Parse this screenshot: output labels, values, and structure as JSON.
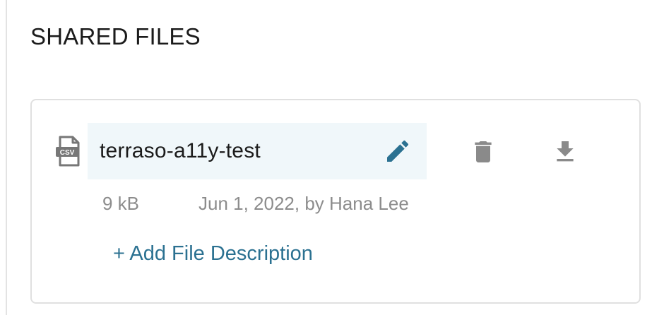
{
  "section": {
    "title": "SHARED FILES"
  },
  "file": {
    "type_badge": "CSV",
    "name": "terraso-a11y-test",
    "size": "9 kB",
    "uploaded": "Jun 1, 2022, by Hana Lee",
    "add_description_label": "+ Add File Description"
  },
  "icons": {
    "file_type": "csv-file-icon",
    "edit": "pencil-icon",
    "delete": "trash-icon",
    "download": "download-icon"
  },
  "colors": {
    "accent": "#2b7191",
    "name_highlight": "#f0f7fa",
    "icon_gray": "#8a8a8a",
    "meta_text": "#8c8c8c"
  }
}
